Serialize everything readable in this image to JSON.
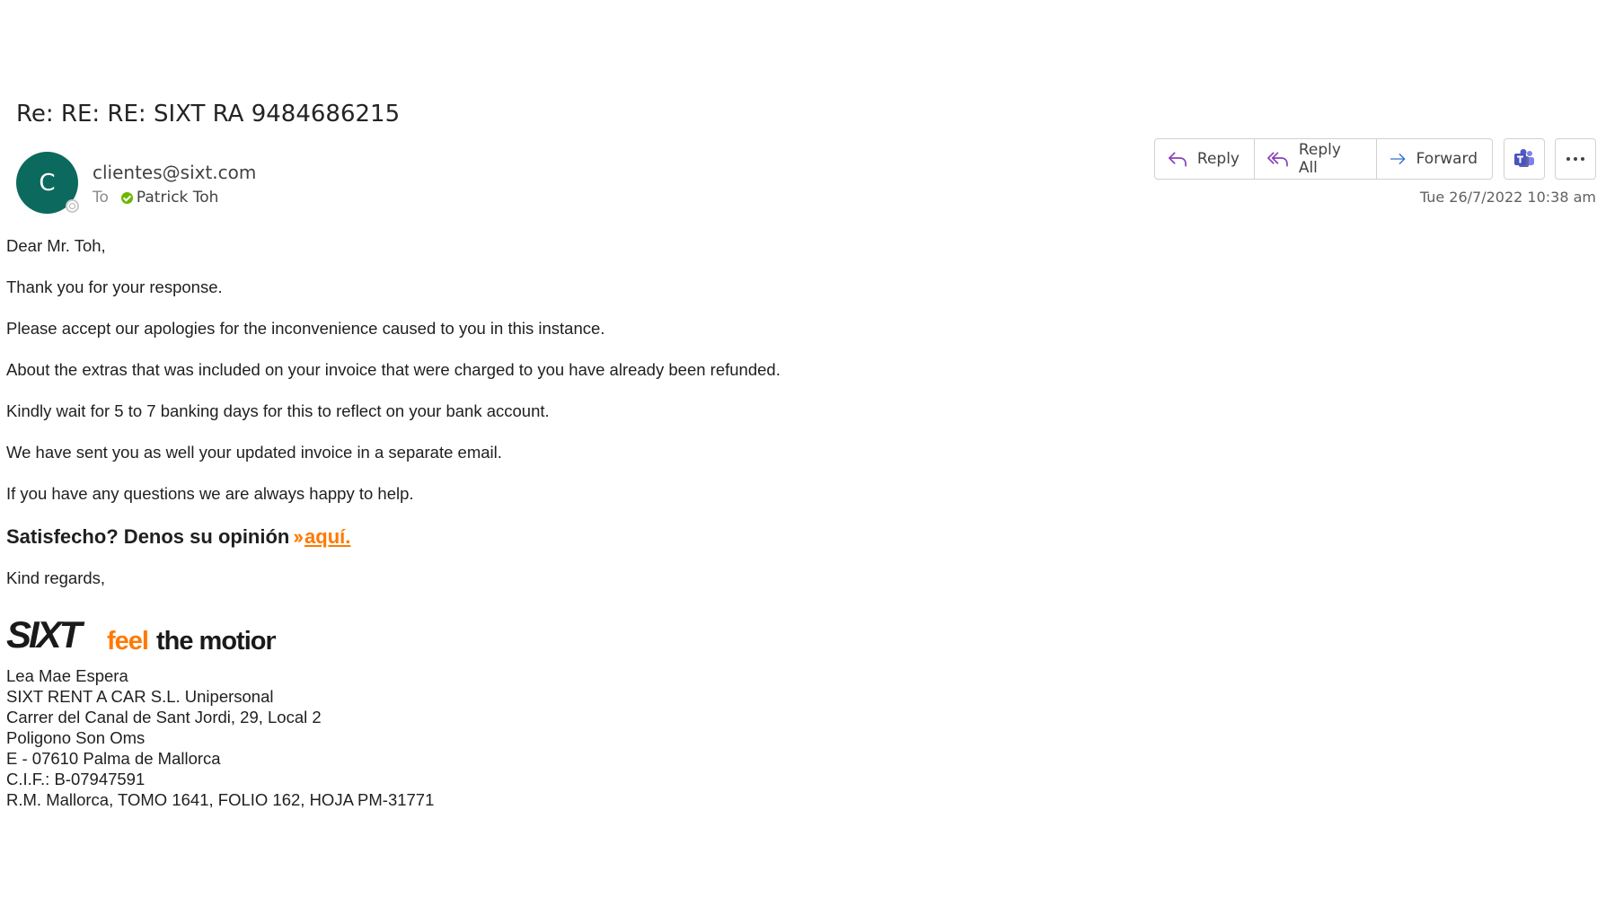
{
  "email": {
    "subject": "Re: RE: RE: SIXT RA 9484686215",
    "avatar_initial": "C",
    "sender": "clientes@sixt.com",
    "to_label": "To",
    "recipient": "Patrick Toh",
    "timestamp": "Tue 26/7/2022 10:38 am"
  },
  "toolbar": {
    "reply_label": "Reply",
    "reply_all_label": "Reply All",
    "forward_label": "Forward",
    "teams_icon": "teams-icon",
    "more_icon": "more-icon"
  },
  "body": {
    "greeting": "Dear Mr. Toh,",
    "paragraphs": [
      "Thank you for your response.",
      "Please accept our apologies for the inconvenience caused to you in this instance.",
      "About the extras that was included on your invoice that were charged to you have already been refunded.",
      "Kindly wait for 5 to 7 banking days for this to reflect on your bank account.",
      "We have sent you as well your updated invoice in a separate email.",
      "If you have any questions we are always happy to help."
    ],
    "survey_text": "Satisfecho? Denos su opinión",
    "survey_link": "aquí.",
    "closing": "Kind regards,"
  },
  "logo": {
    "brand": "SIXT",
    "tagline_orange": "feel",
    "tagline_dark": "the motion."
  },
  "signature": [
    "Lea Mae Espera",
    "SIXT RENT A CAR S.L. Unipersonal",
    "Carrer del Canal de Sant Jordi, 29, Local 2",
    "Poligono Son Oms",
    "E - 07610 Palma de Mallorca",
    "C.I.F.: B-07947591",
    "R.M. Mallorca, TOMO 1641, FOLIO 162, HOJA PM-31771"
  ],
  "colors": {
    "avatar": "#0b6a5d",
    "accent_orange": "#ff7900",
    "reply_icon": "#8a3fb8",
    "forward_icon": "#2f6fd6",
    "teams": "#5059c9"
  }
}
